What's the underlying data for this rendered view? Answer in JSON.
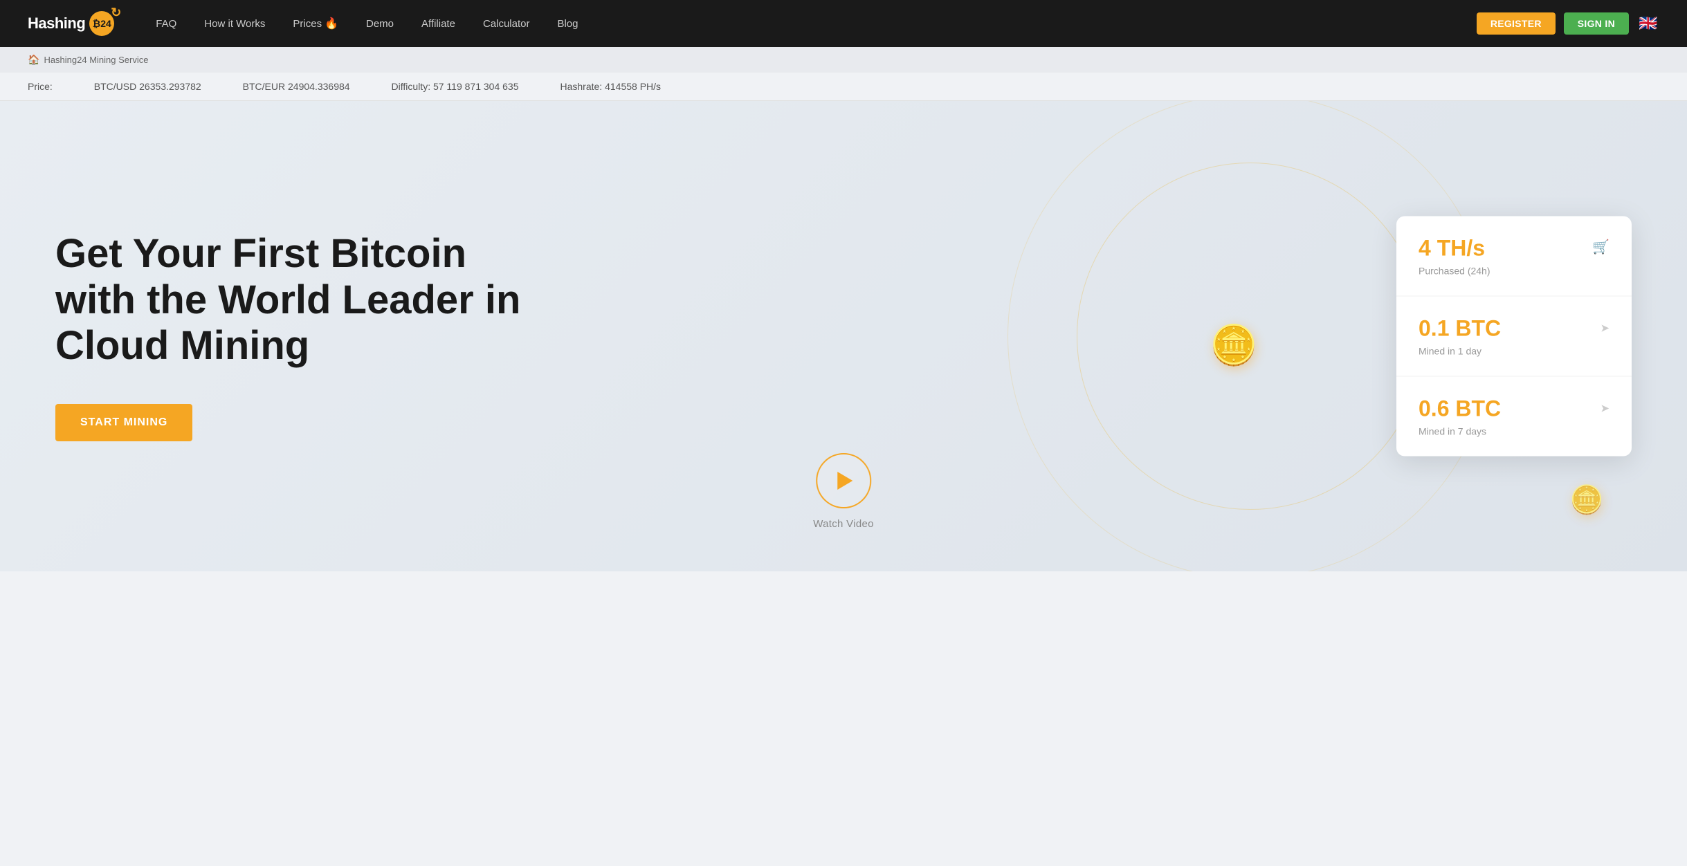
{
  "nav": {
    "logo_text": "Hashing",
    "logo_badge": "₿24",
    "links": [
      {
        "id": "faq",
        "label": "FAQ",
        "has_fire": false
      },
      {
        "id": "how-it-works",
        "label": "How it Works",
        "has_fire": false
      },
      {
        "id": "prices",
        "label": "Prices",
        "has_fire": true
      },
      {
        "id": "demo",
        "label": "Demo",
        "has_fire": false
      },
      {
        "id": "affiliate",
        "label": "Affiliate",
        "has_fire": false
      },
      {
        "id": "calculator",
        "label": "Calculator",
        "has_fire": false
      },
      {
        "id": "blog",
        "label": "Blog",
        "has_fire": false
      }
    ],
    "register_label": "REGISTER",
    "signin_label": "SIGN IN",
    "flag": "🇬🇧"
  },
  "breadcrumb": {
    "home_label": "Hashing24 Mining Service"
  },
  "ticker": {
    "price_label": "Price:",
    "btc_usd": "BTC/USD 26353.293782",
    "btc_eur": "BTC/EUR 24904.336984",
    "difficulty": "Difficulty: 57 119 871 304 635",
    "hashrate": "Hashrate: 414558 PH/s"
  },
  "hero": {
    "title_line1": "Get Your First Bitcoin",
    "title_line2": "with the World Leader in",
    "title_line3": "Cloud Mining",
    "start_mining_label": "START MINING",
    "watch_video_label": "Watch Video"
  },
  "stats": [
    {
      "id": "hashrate-purchased",
      "value": "4 TH/s",
      "label": "Purchased (24h)",
      "icon_type": "cart"
    },
    {
      "id": "btc-mined-1day",
      "value": "0.1 BTC",
      "label": "Mined in 1 day",
      "icon_type": "arrow"
    },
    {
      "id": "btc-mined-7days",
      "value": "0.6 BTC",
      "label": "Mined in 7 days",
      "icon_type": "arrow"
    }
  ]
}
